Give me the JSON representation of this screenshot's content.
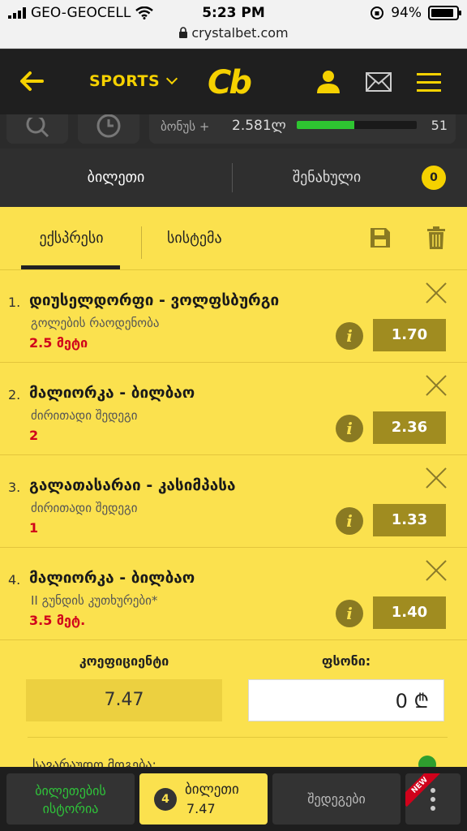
{
  "status_bar": {
    "carrier": "GEO-GEOCELL",
    "time": "5:23 PM",
    "battery": "94%",
    "url": "crystalbet.com"
  },
  "header": {
    "back_icon": "arrow-left-icon",
    "sports_label": "SPORTS",
    "logo": "Cb",
    "icons": [
      "user-icon",
      "mail-icon",
      "menu-icon"
    ],
    "accent_color": "#f5d100"
  },
  "tools": {
    "balance_label": "ბონუს +",
    "balance_value": "2.581ლ",
    "progress": 0.48,
    "count": "51"
  },
  "ticket_tabs": {
    "ticket": "ბილეთი",
    "saved": "შენახული",
    "saved_count": "0"
  },
  "sub_tabs": {
    "express": "ექსპრესი",
    "system": "სისტემა"
  },
  "bets": [
    {
      "num": "1.",
      "title": "დიუსელდორფი - ვოლფსბურგი",
      "market": "გოლების რაოდენობა",
      "pick": "2.5 მეტი",
      "odd": "1.70"
    },
    {
      "num": "2.",
      "title": "მალიორკა - ბილბაო",
      "market": "ძირითადი შედეგი",
      "pick": "2",
      "odd": "2.36"
    },
    {
      "num": "3.",
      "title": "გალათასარაი - კასიმპასა",
      "market": "ძირითადი შედეგი",
      "pick": "1",
      "odd": "1.33"
    },
    {
      "num": "4.",
      "title": "მალიორკა - ბილბაო",
      "market": "II გუნდის კუთხურები*",
      "pick": "3.5 მეტ.",
      "odd": "1.40"
    }
  ],
  "summary": {
    "coef_label": "კოეფიციენტი",
    "coef_value": "7.47",
    "stake_label": "ფსონი:",
    "stake_value": "0 ₾",
    "cut_text": "სავარაუდო მოგება:"
  },
  "bottom": {
    "history": "ბილეთების ისტორია",
    "ticket_count": "4",
    "ticket_label": "ბილეთი",
    "ticket_coef": "7.47",
    "results": "შედეგები",
    "new_tag": "NEW"
  }
}
